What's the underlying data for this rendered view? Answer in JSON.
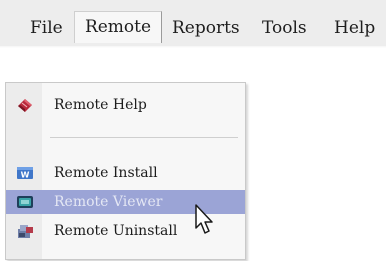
{
  "menubar": {
    "items": [
      {
        "label": "File"
      },
      {
        "label": "Remote"
      },
      {
        "label": "Reports"
      },
      {
        "label": "Tools"
      },
      {
        "label": "Help"
      }
    ],
    "active": "Remote"
  },
  "dropdown": {
    "items": [
      {
        "label": "Remote Help",
        "icon": "book-icon"
      },
      {
        "label": "Remote Install",
        "icon": "install-icon"
      },
      {
        "label": "Remote Viewer",
        "icon": "monitor-icon",
        "highlighted": true
      },
      {
        "label": "Remote Uninstall",
        "icon": "uninstall-icon"
      }
    ]
  },
  "colors": {
    "menubar_bg": "#ededed",
    "dropdown_bg": "#f7f7f7",
    "highlight_bg": "#9ba4d6",
    "highlight_text": "#e4e7f4"
  }
}
